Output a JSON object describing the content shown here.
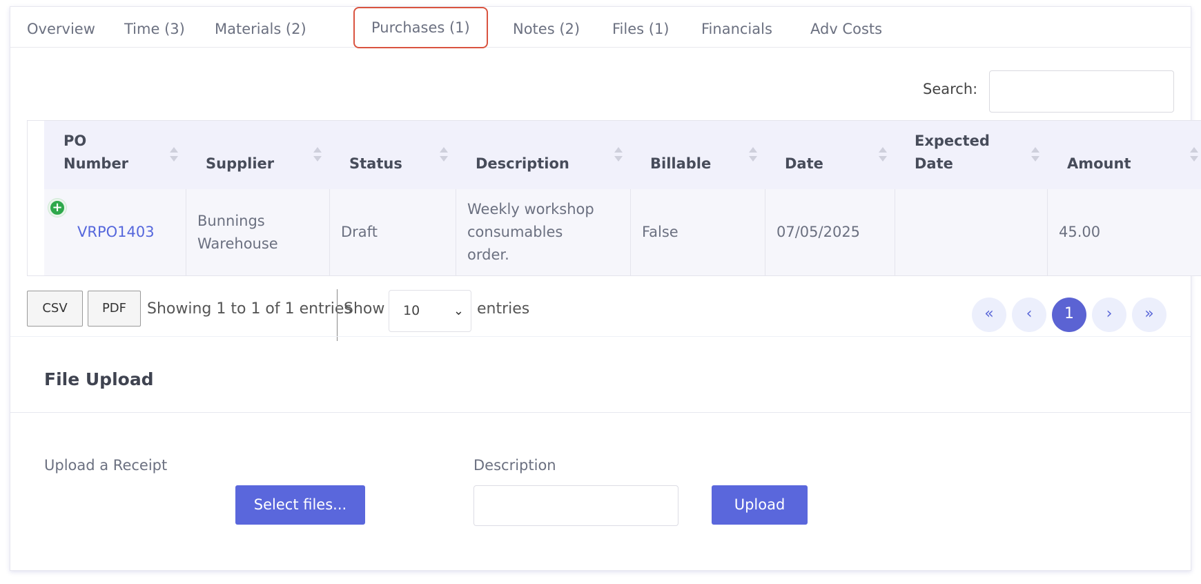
{
  "tabs": [
    {
      "label": "Overview"
    },
    {
      "label": "Time (3)"
    },
    {
      "label": "Materials (2)"
    },
    {
      "label": "Purchases (1)",
      "active": true
    },
    {
      "label": "Notes (2)"
    },
    {
      "label": "Files (1)"
    },
    {
      "label": "Financials"
    },
    {
      "label": "Adv Costs"
    }
  ],
  "search": {
    "label": "Search:",
    "value": ""
  },
  "table": {
    "columns": [
      {
        "line1": "PO",
        "line2": "Number"
      },
      {
        "line1": "",
        "line2": "Supplier"
      },
      {
        "line1": "",
        "line2": "Status"
      },
      {
        "line1": "",
        "line2": "Description"
      },
      {
        "line1": "",
        "line2": "Billable"
      },
      {
        "line1": "",
        "line2": "Date"
      },
      {
        "line1": "Expected",
        "line2": "Date"
      },
      {
        "line1": "",
        "line2": "Amount"
      }
    ],
    "rows": [
      {
        "po_number": "VRPO1403",
        "supplier_line1": "Bunnings",
        "supplier_line2": "Warehouse",
        "status": "Draft",
        "description_line1": "Weekly workshop",
        "description_line2": "consumables",
        "description_line3": "order.",
        "billable": "False",
        "date": "07/05/2025",
        "expected_date": "",
        "amount": "45.00"
      }
    ]
  },
  "footer": {
    "csv_label": "CSV",
    "pdf_label": "PDF",
    "info": "Showing 1 to 1 of 1 entries",
    "show_label": "Show",
    "page_size": "10",
    "entries_label": "entries",
    "pagination": {
      "first": "«",
      "prev": "‹",
      "current": "1",
      "next": "›",
      "last": "»"
    }
  },
  "upload": {
    "title": "File Upload",
    "receipt_label": "Upload a Receipt",
    "select_label": "Select files...",
    "description_label": "Description",
    "description_value": "",
    "upload_label": "Upload"
  },
  "colors": {
    "accent": "#5a67dc",
    "active_tab_border": "#d9533f",
    "expand_icon": "#2ea84b"
  }
}
